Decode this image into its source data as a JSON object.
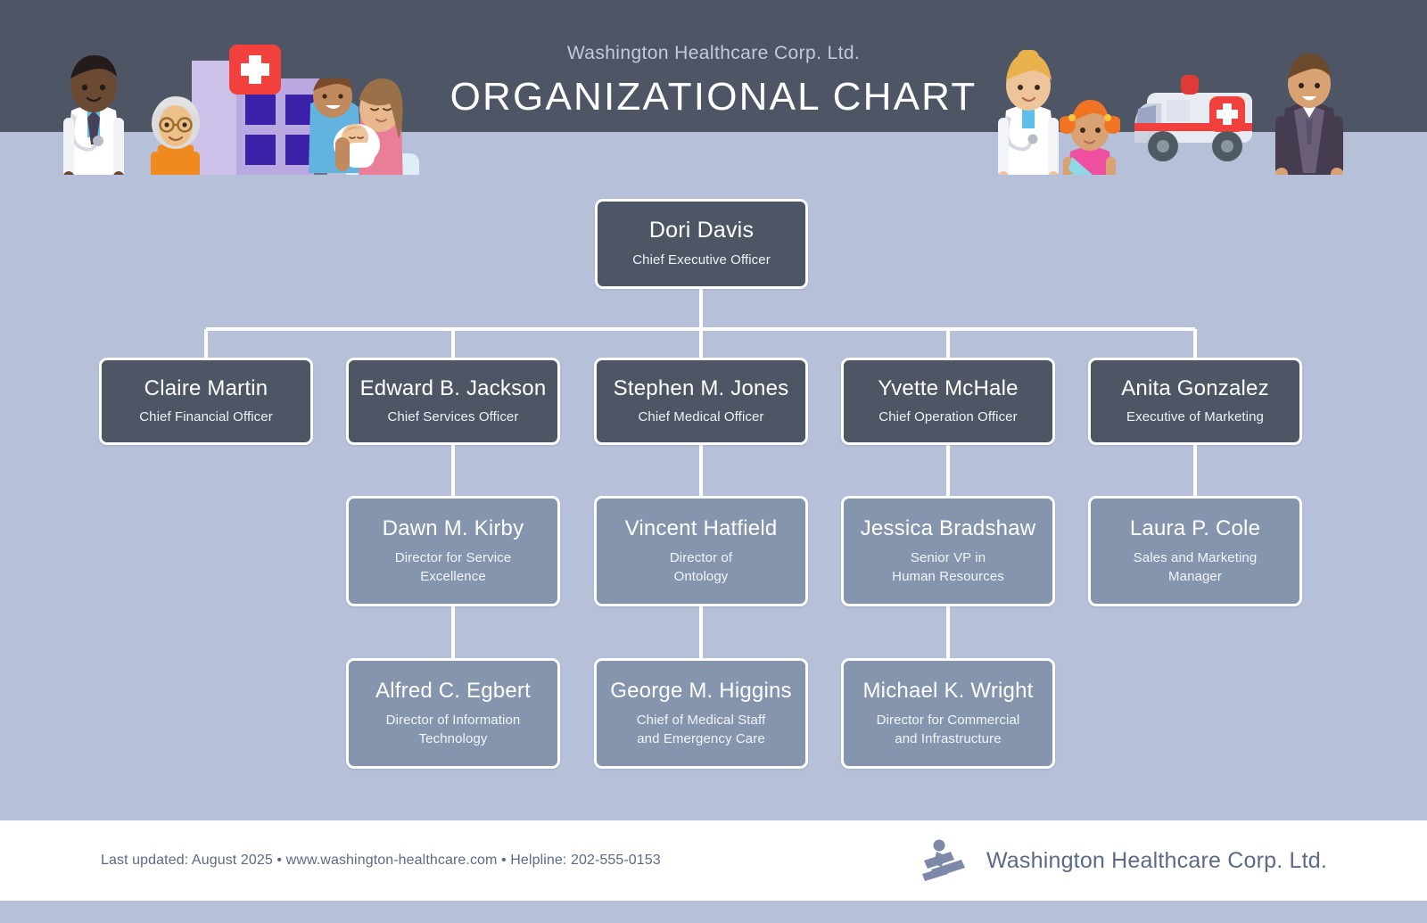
{
  "header": {
    "subtitle": "Washington Healthcare Corp. Ltd.",
    "title": "ORGANIZATIONAL CHART",
    "background_color": "#4e5666",
    "illustrations": [
      "male-doctor-illustration",
      "elderly-woman-wheelchair-illustration",
      "hospital-building-illustration",
      "family-with-newborn-illustration",
      "female-doctor-illustration",
      "injured-girl-illustration",
      "ambulance-illustration",
      "businessman-illustration"
    ]
  },
  "theme": {
    "page_background": "#b6c0d8",
    "dark_node": "#4e5666",
    "light_node": "#8595ae",
    "connector": "#ffffff",
    "footer_background": "#ffffff",
    "footer_text": "#5c6a86"
  },
  "chart_data": {
    "type": "org-chart",
    "title": "ORGANIZATIONAL CHART",
    "subtitle": "Washington Healthcare Corp. Ltd.",
    "levels": 4,
    "nodes": [
      {
        "id": "n0",
        "name": "Dori Davis",
        "title": "Chief Executive Officer",
        "level": 1,
        "style": "dark",
        "parent": null
      },
      {
        "id": "n1",
        "name": "Claire Martin",
        "title": "Chief Financial Officer",
        "level": 2,
        "style": "dark",
        "parent": "n0"
      },
      {
        "id": "n2",
        "name": "Edward B. Jackson",
        "title": "Chief Services Officer",
        "level": 2,
        "style": "dark",
        "parent": "n0"
      },
      {
        "id": "n3",
        "name": "Stephen M. Jones",
        "title": "Chief Medical Officer",
        "level": 2,
        "style": "dark",
        "parent": "n0"
      },
      {
        "id": "n4",
        "name": "Yvette McHale",
        "title": "Chief Operation Officer",
        "level": 2,
        "style": "dark",
        "parent": "n0"
      },
      {
        "id": "n5",
        "name": "Anita Gonzalez",
        "title": "Executive of Marketing",
        "level": 2,
        "style": "dark",
        "parent": "n0"
      },
      {
        "id": "n6",
        "name": "Dawn M. Kirby",
        "title": "Director for Service\nExcellence",
        "level": 3,
        "style": "light",
        "parent": "n2"
      },
      {
        "id": "n7",
        "name": "Vincent Hatfield",
        "title": "Director of\nOntology",
        "level": 3,
        "style": "light",
        "parent": "n3"
      },
      {
        "id": "n8",
        "name": "Jessica Bradshaw",
        "title": "Senior VP in\nHuman Resources",
        "level": 3,
        "style": "light",
        "parent": "n4"
      },
      {
        "id": "n9",
        "name": "Laura P. Cole",
        "title": "Sales and Marketing\nManager",
        "level": 3,
        "style": "light",
        "parent": "n5"
      },
      {
        "id": "n10",
        "name": "Alfred C. Egbert",
        "title": "Director of Information\nTechnology",
        "level": 4,
        "style": "light",
        "parent": "n6"
      },
      {
        "id": "n11",
        "name": "George M. Higgins",
        "title": "Chief of Medical Staff\nand Emergency Care",
        "level": 4,
        "style": "light",
        "parent": "n7"
      },
      {
        "id": "n12",
        "name": "Michael K. Wright",
        "title": "Director for Commercial\nand Infrastructure",
        "level": 4,
        "style": "light",
        "parent": "n8"
      }
    ]
  },
  "footer": {
    "note": "Last updated: August 2025 • www.washington-healthcare.com • Helpline: 202-555-0153",
    "brand": "Washington Healthcare Corp. Ltd.",
    "logo_icon": "running-person-logo-icon"
  }
}
